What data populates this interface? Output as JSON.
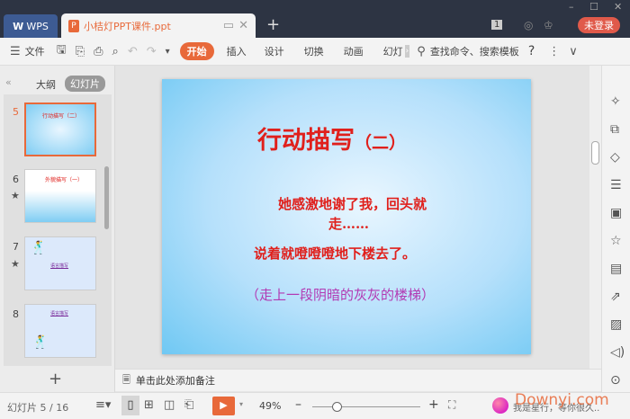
{
  "titlebar": {
    "home_tab": "WPS",
    "doc_tab": "小桔灯PPT课件.ppt",
    "new_tab": "+",
    "login": "未登录",
    "badge": "1"
  },
  "toolbar": {
    "file": "文件",
    "tabs": [
      "开始",
      "插入",
      "设计",
      "切换",
      "动画",
      "幻灯"
    ],
    "search": "查找命令、搜索模板",
    "help": "?"
  },
  "leftpane": {
    "outline_tab": "大纲",
    "slides_tab": "幻灯片",
    "add": "+"
  },
  "thumbs": [
    {
      "num": "5",
      "title": "行动描写（二）"
    },
    {
      "num": "6",
      "title": "外貌描写（一）"
    },
    {
      "num": "7",
      "title": "语言描写"
    },
    {
      "num": "8",
      "title": "语言描写"
    }
  ],
  "slide": {
    "title": "行动描写",
    "title_suffix": "（二）",
    "line1": "她感激地谢了我，回头就",
    "line2": "走……",
    "line3": "说着就噔噔噔地下楼去了。",
    "line4": "（走上一段阴暗的灰灰的楼梯）"
  },
  "notes": {
    "placeholder": "单击此处添加备注"
  },
  "status": {
    "slide_info": "幻灯片 5 / 16",
    "zoom": "49%",
    "ai_text": "我是星行，等你很久..",
    "watermark": "Downyi.com"
  },
  "colors": {
    "accent": "#e8693a",
    "title_red": "#e0201c",
    "purple": "#b23ab3"
  }
}
